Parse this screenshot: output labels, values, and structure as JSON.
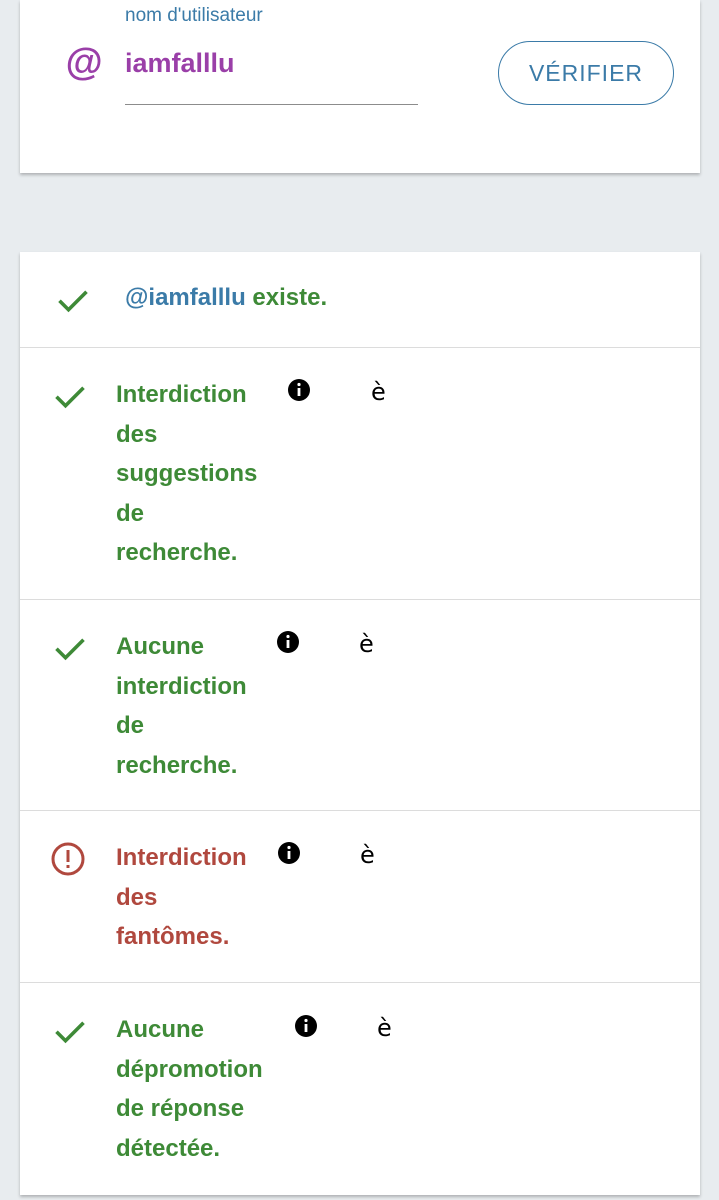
{
  "username_card": {
    "field_label": "nom d'utilisateur",
    "field_value": "iamfalllu",
    "at_symbol": "@",
    "verify_button": "VÉRIFIER"
  },
  "results": {
    "exists_row": {
      "handle": "@iamfalllu",
      "suffix": " existe.",
      "status": "ok"
    },
    "checks": [
      {
        "lines": [
          "Interdiction",
          "des",
          "suggestions",
          "de",
          "recherche."
        ],
        "status": "ok",
        "extra_char": "è"
      },
      {
        "lines": [
          "Aucune",
          "interdiction",
          "de",
          "recherche."
        ],
        "status": "ok",
        "extra_char": "è"
      },
      {
        "lines": [
          "Interdiction",
          "des",
          "fantômes."
        ],
        "status": "warning",
        "extra_char": "è"
      },
      {
        "lines": [
          "Aucune",
          "dépromotion",
          "de réponse",
          "détectée."
        ],
        "status": "ok",
        "extra_char": "è"
      }
    ]
  },
  "colors": {
    "ok_green": "#3e8a37",
    "warning_red": "#b0483e",
    "accent_blue": "#3b7ba8",
    "username_purple": "#9a3fa8",
    "background": "#e8ecef"
  },
  "icons": {
    "at": "at-icon",
    "check": "check-icon",
    "warning": "exclamation-circle-icon",
    "info": "info-icon"
  }
}
